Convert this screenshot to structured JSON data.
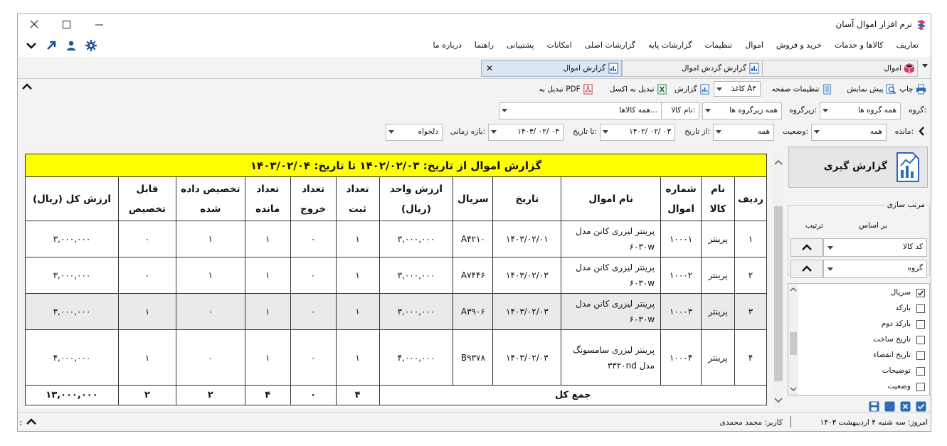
{
  "window": {
    "title": "نرم افزار اموال آسان"
  },
  "menu": [
    "تعاریف",
    "کالاها و خدمات",
    "خرید و فروش",
    "اموال",
    "تنظیمات",
    "گزارشات پایه",
    "گزارشات اصلی",
    "امکانات",
    "پشتیبانی",
    "راهنما",
    "درباره ما"
  ],
  "tabs": [
    {
      "label": "اموال"
    },
    {
      "label": "گزارش گردش اموال"
    },
    {
      "label": "گزارش اموال"
    }
  ],
  "toolbar": {
    "print": "چاپ",
    "preview": "پیش نمایش",
    "page_setup": "تنظیمات صفحه",
    "paper": "کاغذ A۴",
    "report": "گزارش",
    "excel": "تبدیل به اکسل",
    "pdf": "تبدیل به PDF"
  },
  "filters": {
    "group_label": "گروه:",
    "group_value": "همه گروه ها",
    "subgroup_label": "زیرگروه:",
    "subgroup_value": "همه زیرگروه ها",
    "item_label": "نام کالا:",
    "item_value": "همه کالاها...",
    "balance_label": "مانده:",
    "balance_value": "همه",
    "status_label": "وضعیت:",
    "status_value": "همه",
    "from_label": "از تاریخ:",
    "from_value": "۱۴۰۲/ ۰۲/ ۰۳",
    "to_label": "تا تاریخ:",
    "to_value": "۱۴۰۳/ ۰۲/ ۰۴",
    "period_label": "بازه زمانی:",
    "period_value": "دلخواه"
  },
  "report": {
    "title": "گزارش اموال از تاریخ: ۱۴۰۲/۰۲/۰۳ تا تاریخ: ۱۴۰۳/۰۲/۰۴",
    "headers": [
      "ردیف",
      "نام کالا",
      "شماره اموال",
      "نام اموال",
      "تاریخ",
      "سریال",
      "ارزش واحد (ریال)",
      "تعداد ثبت",
      "تعداد خروج",
      "تعداد مانده",
      "تخصیص داده شده",
      "قابل تخصیص",
      "ارزش کل (ریال)"
    ],
    "rows": [
      [
        "۱",
        "پرینتر",
        "۱۰۰۰۱",
        "پرینتر لیزری کانن مدل ۶۰۳۰w",
        "۱۴۰۳/۰۲/۰۱",
        "A۴۲۱۰",
        "۳,۰۰۰,۰۰۰",
        "۱",
        "۰",
        "۱",
        "۱",
        "۰",
        "۳,۰۰۰,۰۰۰"
      ],
      [
        "۲",
        "پرینتر",
        "۱۰۰۰۲",
        "پرینتر لیزری کانن مدل ۶۰۳۰w",
        "۱۴۰۳/۰۲/۰۳",
        "A۷۴۴۶",
        "۳,۰۰۰,۰۰۰",
        "۱",
        "۰",
        "۱",
        "۱",
        "۰",
        "۳,۰۰۰,۰۰۰"
      ],
      [
        "۳",
        "پرینتر",
        "۱۰۰۰۳",
        "پرینتر لیزری کانن مدل ۶۰۳۰w",
        "۱۴۰۳/۰۲/۰۳",
        "A۳۹۰۶",
        "۳,۰۰۰,۰۰۰",
        "۱",
        "۰",
        "۱",
        "۰",
        "۱",
        "۳,۰۰۰,۰۰۰"
      ],
      [
        "۴",
        "پرینتر",
        "۱۰۰۰۴",
        "پرینتر لیزری سامسونگ مدل ۳۳۲۰nd",
        "۱۴۰۳/۰۲/۰۳",
        "B۹۳۷۸",
        "۴,۰۰۰,۰۰۰",
        "۱",
        "۰",
        "۱",
        "۰",
        "۱",
        "۴,۰۰۰,۰۰۰"
      ]
    ],
    "total_label": "جمع کل",
    "totals": [
      "۴",
      "۰",
      "۴",
      "۲",
      "۲",
      "۱۳,۰۰۰,۰۰۰"
    ]
  },
  "side": {
    "report_button": "گزارش گیری",
    "sort_title": "مرتب سازی",
    "sort_by": "بر اساس",
    "sort_order": "ترتیب",
    "sort1": "کد کالا",
    "sort2": "گروه",
    "columns": [
      {
        "label": "سریال",
        "checked": true
      },
      {
        "label": "بارکد",
        "checked": false
      },
      {
        "label": "بارکد دوم",
        "checked": false
      },
      {
        "label": "تاریخ ساخت",
        "checked": false
      },
      {
        "label": "تاریخ انقضاء",
        "checked": false
      },
      {
        "label": "توضیحات",
        "checked": false
      },
      {
        "label": "وضعیت",
        "checked": false
      }
    ]
  },
  "status": {
    "today": "امروز: سه شنبه ۴ اردیبهشت ۱۴۰۳",
    "user": "کاربر: محمد محمدی"
  }
}
